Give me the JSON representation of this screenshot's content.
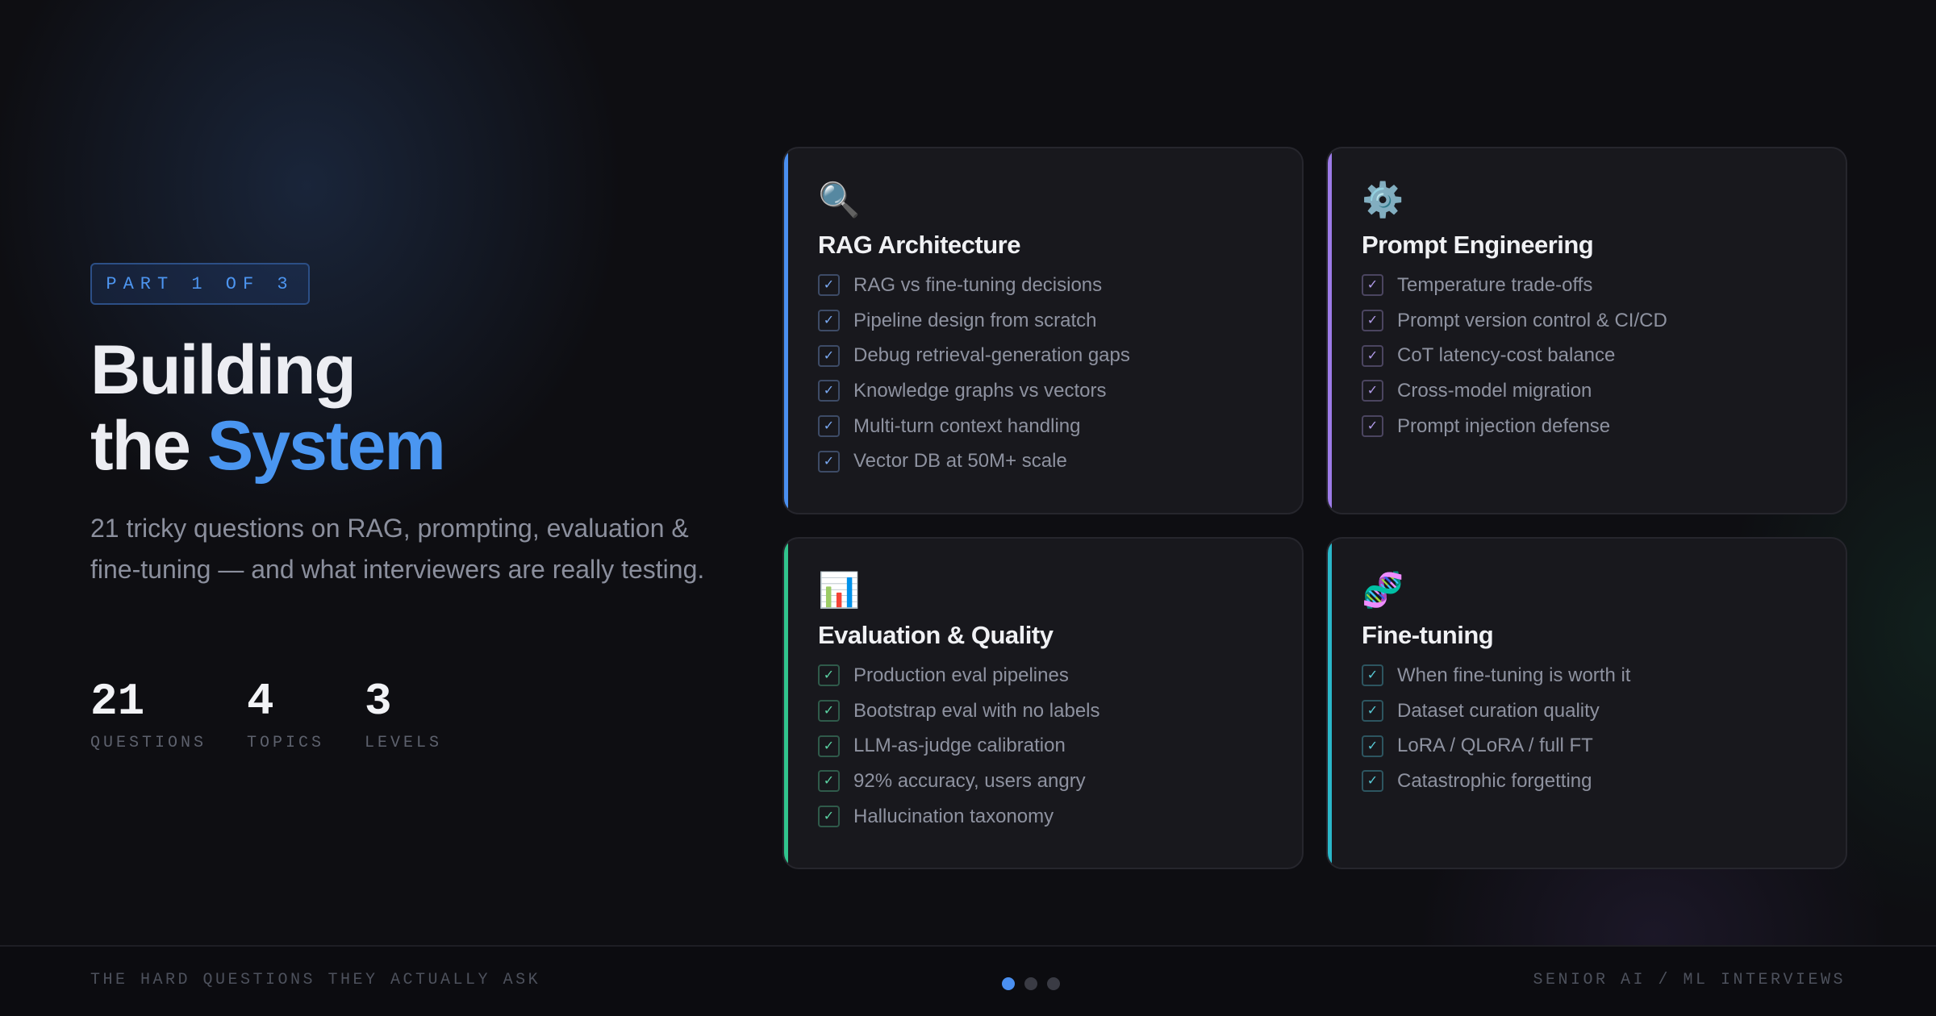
{
  "badge": "PART 1 OF 3",
  "title": {
    "line1": "Building",
    "line2_prefix": "the",
    "line2_accent": "System"
  },
  "subtitle": "21 tricky questions on RAG, prompting, evaluation & fine-tuning — and what interviewers are really testing.",
  "stats": [
    {
      "value": "21",
      "label": "QUESTIONS"
    },
    {
      "value": "4",
      "label": "TOPICS"
    },
    {
      "value": "3",
      "label": "LEVELS"
    }
  ],
  "cards": [
    {
      "icon": "🔍",
      "icon_name": "magnifier-icon",
      "title": "RAG Architecture",
      "accent": "#4a8ff0",
      "items": [
        "RAG vs fine-tuning decisions",
        "Pipeline design from scratch",
        "Debug retrieval-generation gaps",
        "Knowledge graphs vs vectors",
        "Multi-turn context handling",
        "Vector DB at 50M+ scale"
      ]
    },
    {
      "icon": "⚙️",
      "icon_name": "gear-icon",
      "title": "Prompt Engineering",
      "accent": "#9d7be8",
      "items": [
        "Temperature trade-offs",
        "Prompt version control & CI/CD",
        "CoT latency-cost balance",
        "Cross-model migration",
        "Prompt injection defense"
      ]
    },
    {
      "icon": "📊",
      "icon_name": "bar-chart-icon",
      "title": "Evaluation & Quality",
      "accent": "#31c48d",
      "items": [
        "Production eval pipelines",
        "Bootstrap eval with no labels",
        "LLM-as-judge calibration",
        "92% accuracy, users angry",
        "Hallucination taxonomy"
      ]
    },
    {
      "icon": "🧬",
      "icon_name": "dna-icon",
      "title": "Fine-tuning",
      "accent": "#2ab7c9",
      "items": [
        "When fine-tuning is worth it",
        "Dataset curation quality",
        "LoRA / QLoRA / full FT",
        "Catastrophic forgetting"
      ]
    }
  ],
  "check_glyph": "✓",
  "footer": {
    "left": "THE HARD QUESTIONS THEY ACTUALLY ASK",
    "right": "SENIOR AI / ML INTERVIEWS",
    "active_page": 1,
    "page_count": 3
  }
}
